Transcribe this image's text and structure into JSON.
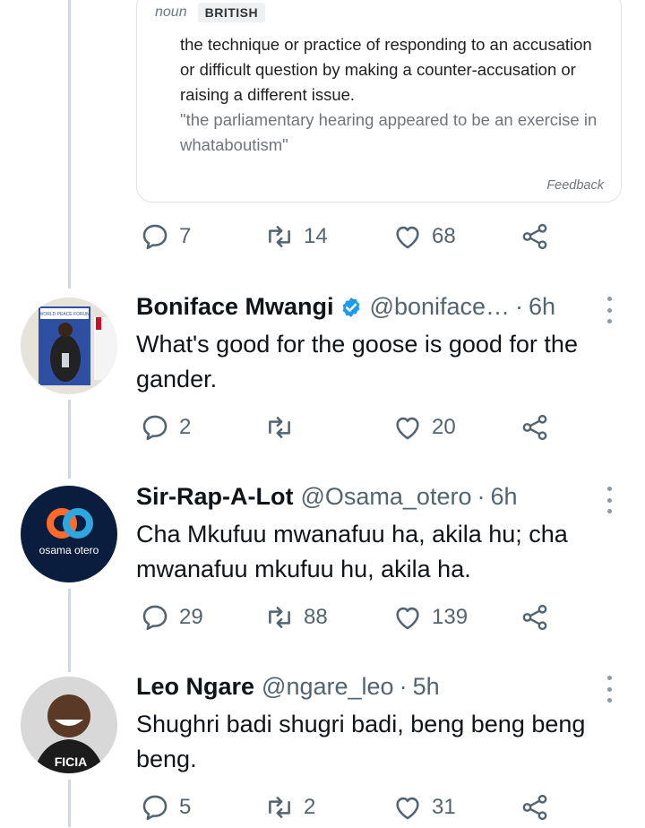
{
  "definition_card": {
    "part_of_speech": "noun",
    "region_label": "BRITISH",
    "definition": "the technique or practice of responding to an accusation or difficult question by making a counter-accusation or raising a different issue.",
    "example": "\"the parliamentary hearing appeared to be an exercise in whataboutism\"",
    "feedback": "Feedback"
  },
  "parent_actions": {
    "replies": "7",
    "retweets": "14",
    "likes": "68"
  },
  "tweets": [
    {
      "name": "Boniface Mwangi",
      "verified": true,
      "handle": "@boniface…",
      "separator": "·",
      "time": "6h",
      "text": "What's good for the goose is good for the gander.",
      "replies": "2",
      "retweets": "",
      "likes": "20",
      "avatar_text": "WORLD PEACE FORUM"
    },
    {
      "name": "Sir-Rap-A-Lot",
      "verified": false,
      "handle": "@Osama_otero",
      "separator": "·",
      "time": "6h",
      "text": "Cha Mkufuu mwanafuu ha, akila hu; cha mwanafuu mkufuu hu, akila ha.",
      "replies": "29",
      "retweets": "88",
      "likes": "139",
      "avatar_text": "osama otero"
    },
    {
      "name": "Leo Ngare",
      "verified": false,
      "handle": "@ngare_leo",
      "separator": "·",
      "time": "5h",
      "text": "Shughri badi shugri badi, beng beng beng beng.",
      "replies": "5",
      "retweets": "2",
      "likes": "31",
      "avatar_text": "FICIA"
    }
  ],
  "colors": {
    "accent": "#1d9bf0",
    "muted": "#536471",
    "line": "#cfd9de"
  }
}
